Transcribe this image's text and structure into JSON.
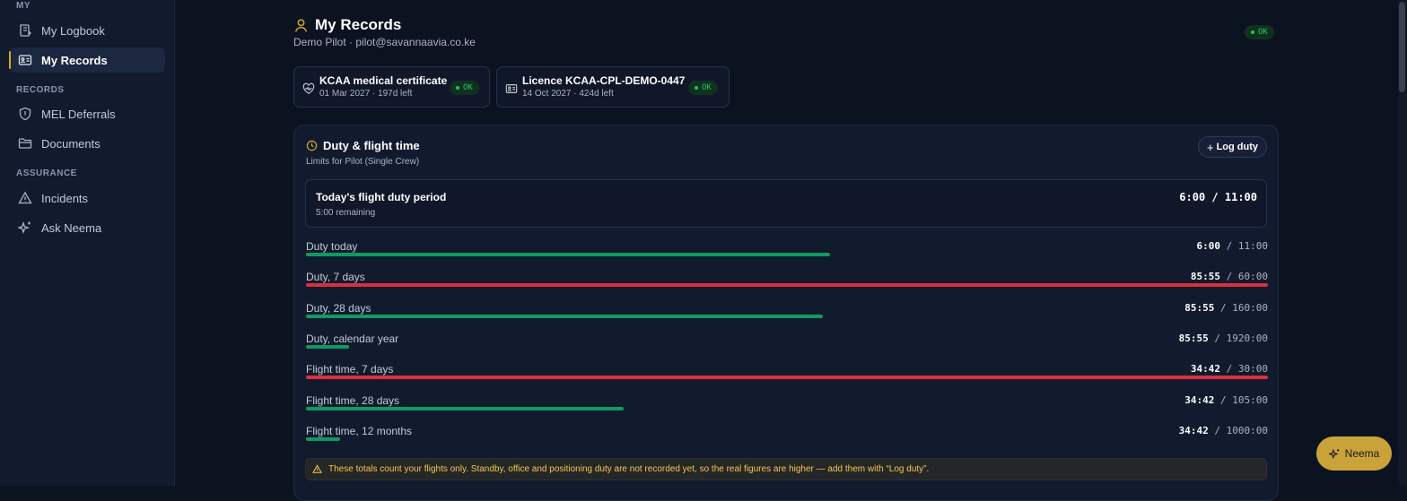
{
  "sidebar": {
    "sections": [
      {
        "label": "MY"
      },
      {
        "label": "RECORDS"
      },
      {
        "label": "ASSURANCE"
      }
    ],
    "items": [
      {
        "label": "My Logbook",
        "icon": "logbook-icon"
      },
      {
        "label": "My Records",
        "icon": "id-card-icon",
        "active": true
      },
      {
        "label": "MEL Deferrals",
        "icon": "shield-icon"
      },
      {
        "label": "Documents",
        "icon": "folder-icon"
      },
      {
        "label": "Incidents",
        "icon": "warning-triangle-icon"
      },
      {
        "label": "Ask Neema",
        "icon": "sparkle-icon"
      }
    ]
  },
  "header": {
    "title": "My Records",
    "subtitle": "Demo Pilot · pilot@savannaavia.co.ke",
    "status": "OK"
  },
  "certificates": [
    {
      "title": "KCAA medical certificate",
      "subtitle": "01 Mar 2027 · 197d left",
      "status": "OK",
      "icon": "heart-pulse-icon"
    },
    {
      "title": "Licence KCAA-CPL-DEMO-0447",
      "subtitle": "14 Oct 2027 · 424d left",
      "status": "OK",
      "icon": "id-card-icon"
    }
  ],
  "duty": {
    "title": "Duty & flight time",
    "subtitle": "Limits for Pilot (Single Crew)",
    "log_button": "Log duty",
    "fdp": {
      "title": "Today's flight duty period",
      "remaining": "5:00 remaining",
      "value": "6:00 / 11:00"
    },
    "limits": [
      {
        "label": "Duty today",
        "used": "6:00",
        "limit": "/ 11:00",
        "fraction": 0.545,
        "status": "ok"
      },
      {
        "label": "Duty, 7 days",
        "used": "85:55",
        "limit": "/ 60:00",
        "fraction": 1.0,
        "status": "over"
      },
      {
        "label": "Duty, 28 days",
        "used": "85:55",
        "limit": "/ 160:00",
        "fraction": 0.537,
        "status": "ok"
      },
      {
        "label": "Duty, calendar year",
        "used": "85:55",
        "limit": "/ 1920:00",
        "fraction": 0.045,
        "status": "ok"
      },
      {
        "label": "Flight time, 7 days",
        "used": "34:42",
        "limit": "/ 30:00",
        "fraction": 1.0,
        "status": "over"
      },
      {
        "label": "Flight time, 28 days",
        "used": "34:42",
        "limit": "/ 105:00",
        "fraction": 0.33,
        "status": "ok"
      },
      {
        "label": "Flight time, 12 months",
        "used": "34:42",
        "limit": "/ 1000:00",
        "fraction": 0.035,
        "status": "ok"
      }
    ],
    "warning": "These totals count your flights only. Standby, office and positioning duty are not recorded yet, so the real figures are higher — add them with “Log duty”."
  },
  "assistant_button": {
    "label": "Neema",
    "icon": "sparkle-icon"
  },
  "colors": {
    "accent": "#d4a72c",
    "ok": "#0f9a62",
    "over": "#dc2f3c",
    "background": "#0b1220"
  }
}
